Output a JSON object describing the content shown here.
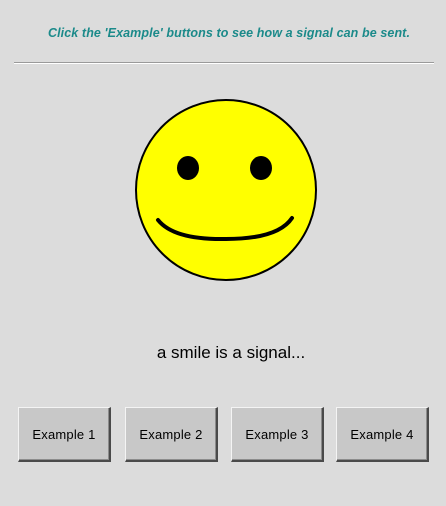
{
  "instruction": "Click the 'Example' buttons to see how a signal can be sent.",
  "smiley": {
    "icon": "smiley-face-icon",
    "face_color": "#ffff00",
    "outline_color": "#000000"
  },
  "caption": "a smile is a signal...",
  "buttons": [
    {
      "label": "Example 1"
    },
    {
      "label": "Example 2"
    },
    {
      "label": "Example 3"
    },
    {
      "label": "Example 4"
    }
  ],
  "colors": {
    "background": "#dcdcdc",
    "instruction_text": "#1b8a8a",
    "button_face": "#c8c8c8"
  }
}
